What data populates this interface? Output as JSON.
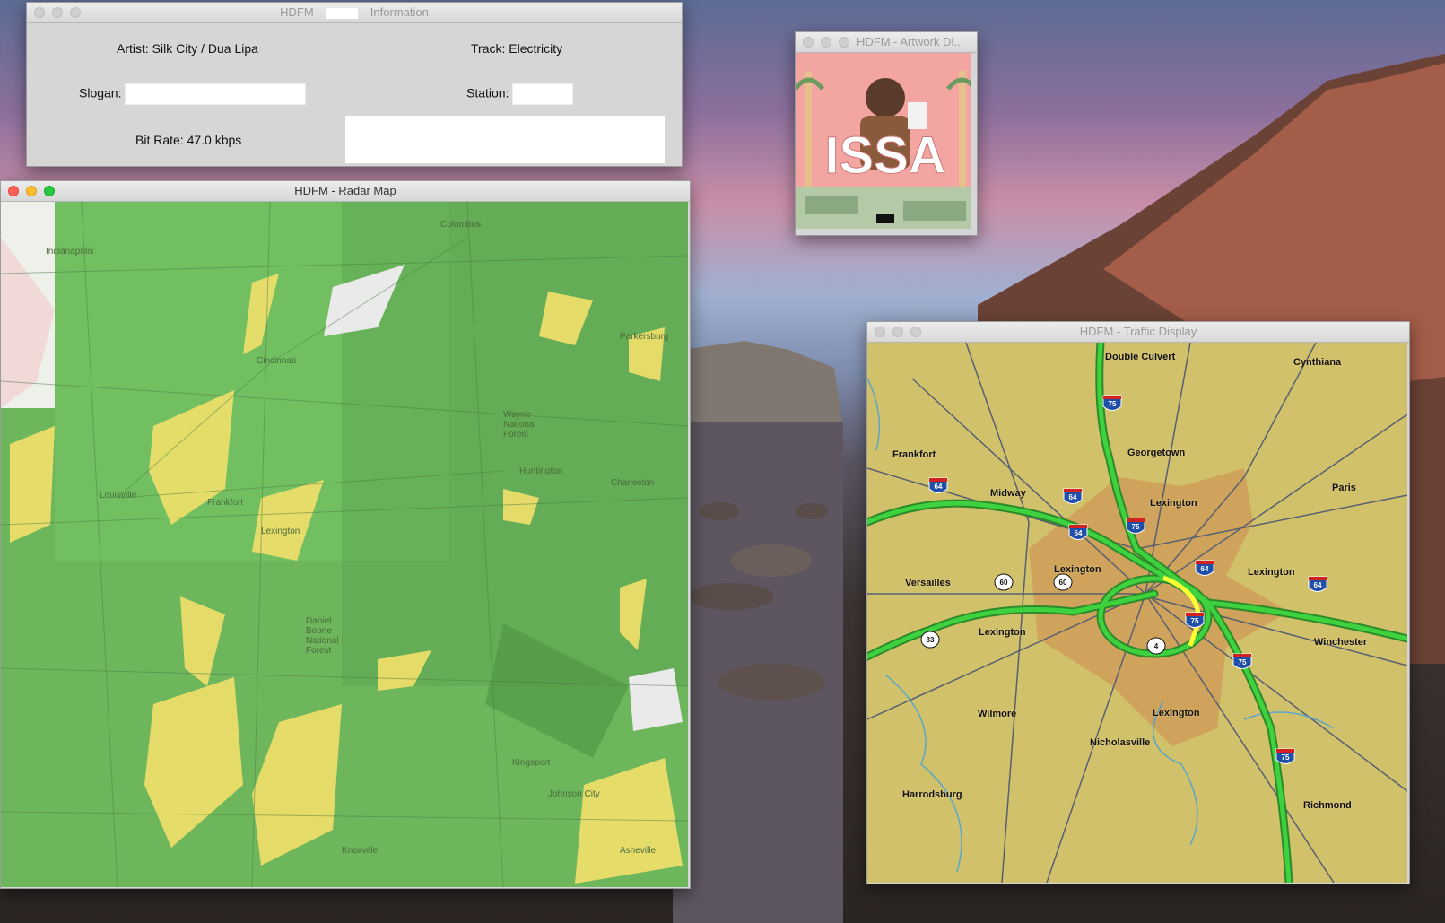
{
  "info_window": {
    "title_prefix": "HDFM - ",
    "title_suffix": " - Information",
    "artist_label": "Artist: Silk City / Dua Lipa",
    "track_label": "Track: Electricity",
    "slogan_label": "Slogan:",
    "slogan_value": "",
    "station_label": "Station:",
    "station_value": "",
    "bitrate_label": "Bit Rate: 47.0 kbps"
  },
  "artwork_window": {
    "title": "HDFM - Artwork Di...",
    "album_text": "ISSA"
  },
  "radar_window": {
    "title": "HDFM - Radar Map",
    "places": [
      "Indianapolis",
      "Columbus",
      "Cincinnati",
      "Louisville",
      "Frankfort",
      "Lexington",
      "Parkersburg",
      "Wayne National Forest",
      "Huntington",
      "Charleston",
      "Daniel Boone National Forest",
      "Kingsport",
      "Johnson City",
      "Knoxville",
      "Asheville"
    ]
  },
  "traffic_window": {
    "title": "HDFM - Traffic Display",
    "places": [
      "Double Culvert",
      "Cynthiana",
      "Frankfort",
      "Georgetown",
      "Midway",
      "Lexington",
      "Paris",
      "Versailles",
      "Lexington",
      "Lexington",
      "Lexington",
      "Winchester",
      "Wilmore",
      "Lexington",
      "Nicholasville",
      "Harrodsburg",
      "Richmond"
    ],
    "shields": [
      "75",
      "64",
      "64",
      "64",
      "75",
      "64",
      "60",
      "60",
      "64",
      "75",
      "33",
      "4",
      "75",
      "75"
    ]
  },
  "colors": {
    "radar_green": "#6fbf5c",
    "radar_yellow": "#f2e06a",
    "traffic_bg": "#d0c16a",
    "traffic_urban": "#cfa35b",
    "road_green": "#38c43a",
    "road_yellow": "#ffff33"
  }
}
